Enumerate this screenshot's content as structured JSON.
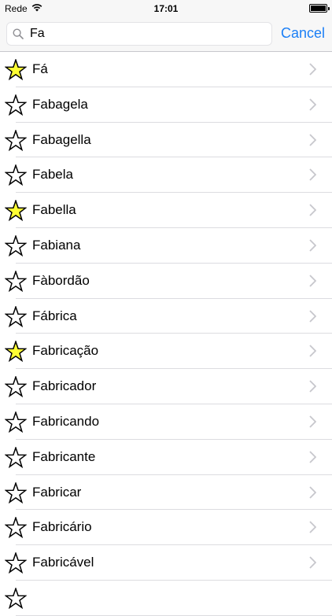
{
  "status_bar": {
    "carrier": "Rede",
    "time": "17:01",
    "wifi_icon": "wifi-icon",
    "battery_level": 1.0
  },
  "search": {
    "value": "Fa",
    "placeholder": "",
    "icon": "search-icon",
    "cancel_label": "Cancel",
    "accent_color": "#1b7ff6"
  },
  "results": [
    {
      "label": "Fá",
      "favorite": true
    },
    {
      "label": "Fabagela",
      "favorite": false
    },
    {
      "label": "Fabagella",
      "favorite": false
    },
    {
      "label": "Fabela",
      "favorite": false
    },
    {
      "label": "Fabella",
      "favorite": true
    },
    {
      "label": "Fabiana",
      "favorite": false
    },
    {
      "label": "Fàbordão",
      "favorite": false
    },
    {
      "label": "Fábrica",
      "favorite": false
    },
    {
      "label": "Fabricação",
      "favorite": true
    },
    {
      "label": "Fabricador",
      "favorite": false
    },
    {
      "label": "Fabricando",
      "favorite": false
    },
    {
      "label": "Fabricante",
      "favorite": false
    },
    {
      "label": "Fabricar",
      "favorite": false
    },
    {
      "label": "Fabricário",
      "favorite": false
    },
    {
      "label": "Fabricável",
      "favorite": false
    },
    {
      "label": "",
      "favorite": false
    }
  ],
  "colors": {
    "favorite_star": "#ffff33",
    "star_outline": "#000000",
    "chevron": "#c7c7cc"
  }
}
